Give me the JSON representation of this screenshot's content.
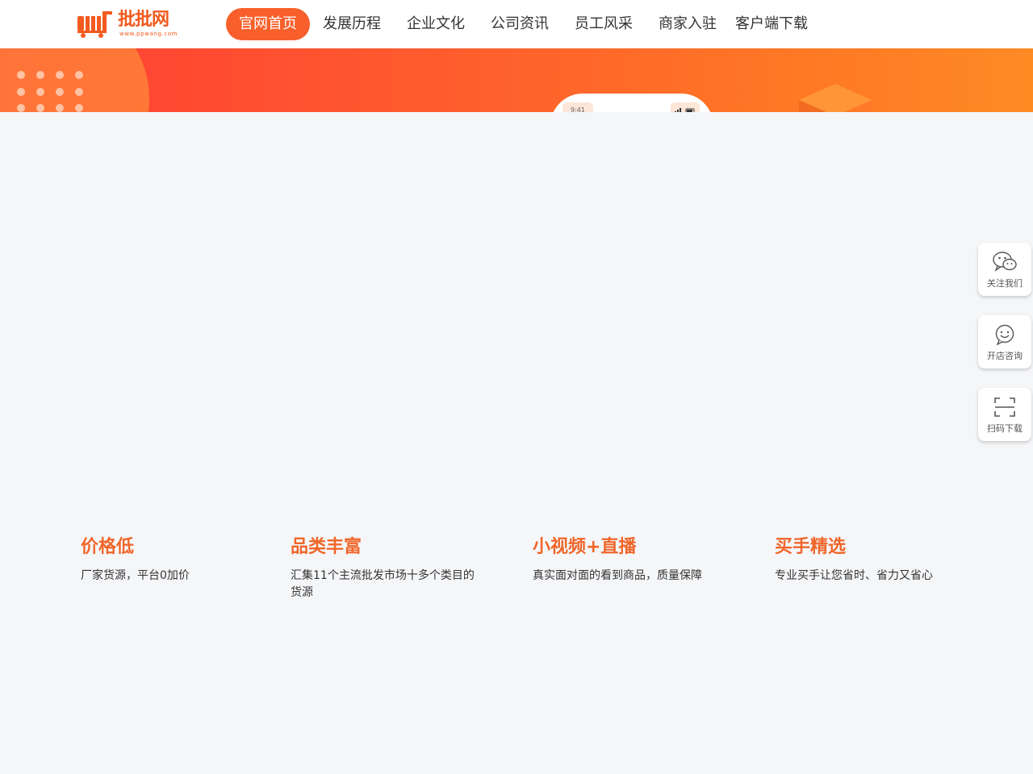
{
  "brand": {
    "name": "批批网",
    "url": "www.ppwang.com",
    "accent": "#f95f2a",
    "title_color": "#f0662a"
  },
  "nav": {
    "items": [
      {
        "label": "官网首页",
        "active": true
      },
      {
        "label": "发展历程",
        "active": false
      },
      {
        "label": "企业文化",
        "active": false
      },
      {
        "label": "公司资讯",
        "active": false
      },
      {
        "label": "员工风采",
        "active": false
      },
      {
        "label": "商家入驻",
        "active": false
      },
      {
        "label": "客户端下载",
        "active": false
      }
    ]
  },
  "banner": {
    "phone_time": "9:41"
  },
  "features": [
    {
      "title": "价格低",
      "desc": "厂家货源，平台0加价"
    },
    {
      "title": "品类丰富",
      "desc": "汇集11个主流批发市场十多个类目的货源"
    },
    {
      "title": "小视频+直播",
      "desc": "真实面对面的看到商品，质量保障"
    },
    {
      "title": "买手精选",
      "desc": "专业买手让您省时、省力又省心"
    }
  ],
  "side_widgets": [
    {
      "label": "关注我们",
      "icon": "wechat-icon"
    },
    {
      "label": "开店咨询",
      "icon": "chat-smile-icon"
    },
    {
      "label": "扫码下载",
      "icon": "scan-icon"
    }
  ]
}
